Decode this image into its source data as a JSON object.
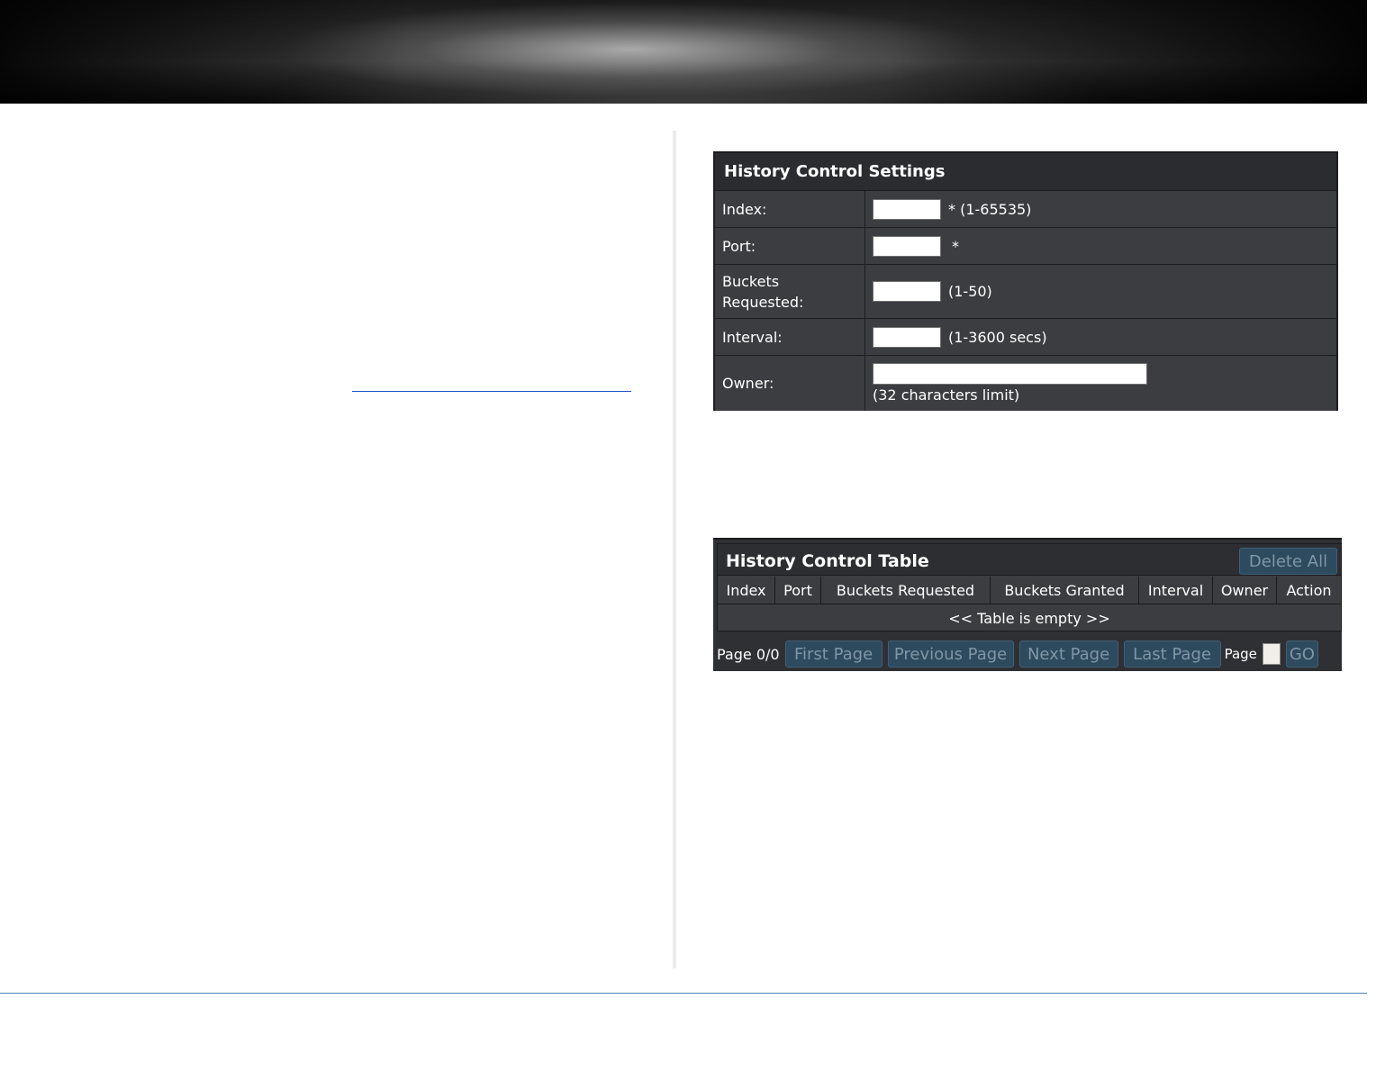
{
  "settings": {
    "title": "History Control Settings",
    "index_label": "Index:",
    "index_value": "",
    "index_hint": "* (1-65535)",
    "port_label": "Port:",
    "port_value": "",
    "port_hint": "*",
    "buckets_label_line1": "Buckets",
    "buckets_label_line2": "Requested:",
    "buckets_value": "",
    "buckets_hint": "(1-50)",
    "interval_label": "Interval:",
    "interval_value": "",
    "interval_hint": "(1-3600 secs)",
    "owner_label": "Owner:",
    "owner_value": "",
    "owner_hint": "(32 characters limit)"
  },
  "table": {
    "title": "History Control Table",
    "delete_all_label": "Delete All",
    "columns": [
      "Index",
      "Port",
      "Buckets Requested",
      "Buckets Granted",
      "Interval",
      "Owner",
      "Action"
    ],
    "empty_text": "<< Table is empty >>"
  },
  "pager": {
    "page_status": "Page 0/0",
    "first_label": "First Page",
    "previous_label": "Previous Page",
    "next_label": "Next Page",
    "last_label": "Last Page",
    "page_label": "Page",
    "page_value": "",
    "go_label": "GO"
  }
}
